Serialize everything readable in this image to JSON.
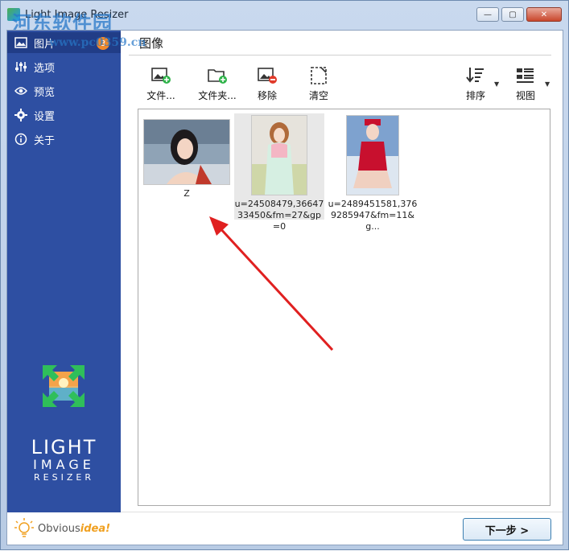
{
  "window": {
    "title": "Light Image Resizer",
    "watermark": "河东软件园",
    "watermark_url": "www.pc0359.cn",
    "minimize_glyph": "—",
    "maximize_glyph": "▢",
    "close_glyph": "✕"
  },
  "sidebar": {
    "items": [
      {
        "label": "图片",
        "icon": "picture-icon",
        "badge": "3"
      },
      {
        "label": "选项",
        "icon": "sliders-icon"
      },
      {
        "label": "预览",
        "icon": "eye-icon"
      },
      {
        "label": "设置",
        "icon": "gear-icon"
      },
      {
        "label": "关于",
        "icon": "info-icon"
      }
    ],
    "logo_line1": "LIGHT",
    "logo_line2": "IMAGE",
    "logo_line3": "RESIZER",
    "brand_text_1": "Obvious",
    "brand_text_2": "idea!"
  },
  "main": {
    "title": "图像",
    "toolbar": {
      "add_files": "文件...",
      "add_folder": "文件夹...",
      "remove": "移除",
      "clear": "清空",
      "sort": "排序",
      "view": "视图"
    },
    "images": [
      {
        "caption": "Z"
      },
      {
        "caption": "u=24508479,3664733450&fm=27&gp=0"
      },
      {
        "caption": "u=2489451581,3769285947&fm=11&g..."
      }
    ],
    "next_button": "下一步 >"
  },
  "colors": {
    "sidebar_bg": "#2e4fa2",
    "sidebar_active": "#213d87",
    "badge": "#f0892b",
    "accent_arrow": "#e02020"
  }
}
